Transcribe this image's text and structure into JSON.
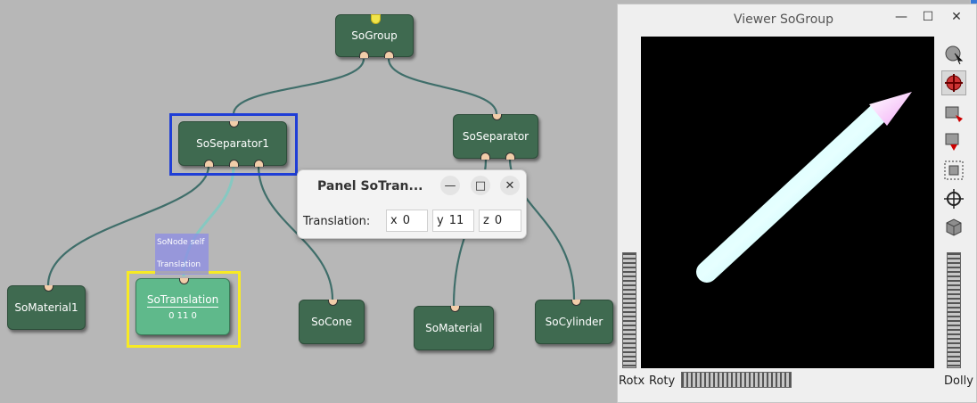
{
  "graph": {
    "nodes": {
      "sogroup": "SoGroup",
      "soseparator1": "SoSeparator1",
      "soseparator": "SoSeparator",
      "somaterial1": "SoMaterial1",
      "sotranslation": "SoTranslation",
      "sotranslation_value": "0 11 0",
      "socone": "SoCone",
      "somaterial": "SoMaterial",
      "socylinder": "SoCylinder"
    },
    "tooltip": {
      "line1": "SoNode self",
      "line2": "Translation"
    }
  },
  "panel": {
    "title": "Panel SoTran...",
    "row_label": "Translation:",
    "fields": [
      {
        "axis": "x",
        "value": "0"
      },
      {
        "axis": "y",
        "value": "11"
      },
      {
        "axis": "z",
        "value": "0"
      }
    ],
    "buttons": {
      "minimize": "—",
      "maximize": "□",
      "close": "✕"
    }
  },
  "viewer": {
    "title": "Viewer SoGroup",
    "buttons": {
      "minimize": "—",
      "maximize": "☐",
      "close": "✕"
    },
    "labels": {
      "rotx": "Rotx",
      "roty": "Roty",
      "dolly": "Dolly"
    },
    "side_icons": [
      "pick-arrow-icon",
      "view-move-icon",
      "home-icon",
      "set-home-icon",
      "view-all-icon",
      "seek-icon",
      "projection-cube-icon"
    ]
  },
  "colors": {
    "background": "#b7b7b7",
    "node": "#3f6a50",
    "node_active": "#5fb98b",
    "port": "#f2cda9",
    "wire": "#3f6e6a",
    "selection_blue": "#1f3ed6",
    "selection_yellow": "#f7ea24"
  }
}
